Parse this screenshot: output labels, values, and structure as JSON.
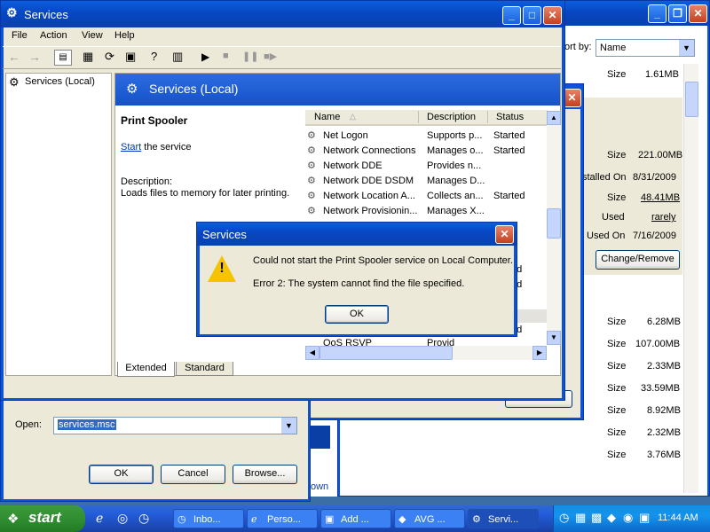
{
  "bg_window": {
    "sort_label": "ort by:",
    "sort_value": "Name",
    "rows": [
      {
        "label": "Size",
        "value": "1.61MB"
      },
      {
        "label": "Size",
        "value": "221.00MB"
      },
      {
        "label": "stalled On",
        "value": "8/31/2009"
      },
      {
        "label": "Size",
        "value": "48.41MB"
      },
      {
        "label": "Used",
        "value": "rarely"
      },
      {
        "label": "Used On",
        "value": "7/16/2009"
      }
    ],
    "change_remove": "Change/Remove",
    "sizes": [
      {
        "label": "Size",
        "value": "6.28MB"
      },
      {
        "label": "Size",
        "value": "107.00MB"
      },
      {
        "label": "Size",
        "value": "2.33MB"
      },
      {
        "label": "Size",
        "value": "33.59MB"
      },
      {
        "label": "Size",
        "value": "8.92MB"
      },
      {
        "label": "Size",
        "value": "2.32MB"
      },
      {
        "label": "Size",
        "value": "3.76MB"
      }
    ]
  },
  "run_dialog": {
    "open_label": "Open:",
    "open_value": "services.msc",
    "ok": "OK",
    "cancel": "Cancel",
    "browse": "Browse...",
    "side_text": "own"
  },
  "services_window": {
    "title": "Services",
    "menu": [
      "File",
      "Action",
      "View",
      "Help"
    ],
    "tree_item": "Services (Local)",
    "header": "Services (Local)",
    "selected_service": "Print Spooler",
    "start_link": "Start",
    "start_rest": " the service",
    "desc_label": "Description:",
    "desc_text": "Loads files to memory for later printing.",
    "columns": {
      "name": "Name",
      "description": "Description",
      "status": "Status"
    },
    "services": [
      {
        "name": "Net Logon",
        "description": "Supports p...",
        "status": "Started"
      },
      {
        "name": "Network Connections",
        "description": "Manages o...",
        "status": "Started"
      },
      {
        "name": "Network DDE",
        "description": "Provides n...",
        "status": ""
      },
      {
        "name": "Network DDE DSDM",
        "description": "Manages D...",
        "status": ""
      },
      {
        "name": "Network Location A...",
        "description": "Collects an...",
        "status": "Started"
      },
      {
        "name": "Network Provisionin...",
        "description": "Manages X...",
        "status": ""
      }
    ],
    "partial_status": [
      "ed",
      "ed",
      "ed"
    ],
    "partial_row": "QoS RSVP",
    "partial_desc": "Provid",
    "tabs": [
      "Extended",
      "Standard"
    ],
    "cancel_peek": "Cancel"
  },
  "error_dialog": {
    "title": "Services",
    "line1": "Could not start the Print Spooler service on Local Computer.",
    "line2": "Error 2: The system cannot find the file specified.",
    "ok": "OK"
  },
  "taskbar": {
    "start": "start",
    "buttons": [
      "Inbo...",
      "Perso...",
      "Add ...",
      "AVG ...",
      "Servi..."
    ],
    "clock": "11:44 AM"
  }
}
